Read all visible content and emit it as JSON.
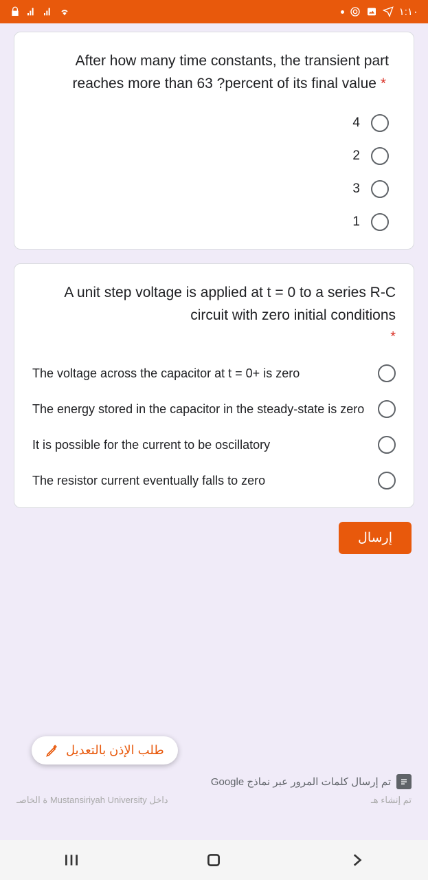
{
  "status": {
    "time": "١:١٠"
  },
  "q1": {
    "text": "After how many time constants, the transient part reaches more than 63 ?percent of its final value",
    "required_mark": "*",
    "options": [
      "4",
      "2",
      "3",
      "1"
    ]
  },
  "q2": {
    "text": "A unit step voltage is applied at t = 0 to a series R-C circuit with zero initial conditions",
    "required_mark": "*",
    "options": [
      "The voltage across the capacitor at t = 0+ is zero",
      "The energy stored in the capacitor in the steady-state is zero",
      "It is possible for the current to be oscillatory",
      "The resistor current eventually falls to zero"
    ]
  },
  "submit_label": "إرسال",
  "edit_chip_label": "طلب الإذن بالتعديل",
  "footer_text": "تم إرسال كلمات المرور عبر نماذج Google",
  "partial_left": "ة الخاصـ Mustansiriyah University داخل",
  "partial_right": "تم إنشاء هـ"
}
